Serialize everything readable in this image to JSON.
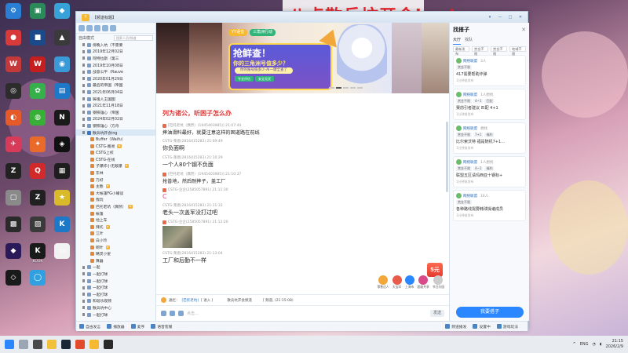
{
  "overlay_text": "八点散兵坑开会ing!",
  "desktop_icons": [
    {
      "label": "",
      "color": "#2a7fd4",
      "glyph": "⚙"
    },
    {
      "label": "",
      "color": "#2a8a5a",
      "glyph": "▣"
    },
    {
      "label": "",
      "color": "#36a2d8",
      "glyph": "◆"
    },
    {
      "label": "",
      "color": "#d83a3a",
      "glyph": "●"
    },
    {
      "label": "",
      "color": "#1a4a8a",
      "glyph": "■"
    },
    {
      "label": "",
      "color": "#3a3a3a",
      "glyph": "▲"
    },
    {
      "label": "",
      "color": "#c43a3a",
      "glyph": "W"
    },
    {
      "label": "",
      "color": "#c41e1e",
      "glyph": "W"
    },
    {
      "label": "",
      "color": "#3a9ad8",
      "glyph": "◉"
    },
    {
      "label": "",
      "color": "#2c2c2c",
      "glyph": "◎"
    },
    {
      "label": "",
      "color": "#35b04a",
      "glyph": "✿"
    },
    {
      "label": "",
      "color": "#1e78c8",
      "glyph": "▤"
    },
    {
      "label": "",
      "color": "#e65a2a",
      "glyph": "◐"
    },
    {
      "label": "",
      "color": "#38b038",
      "glyph": "◍"
    },
    {
      "label": "",
      "color": "#1a1a1a",
      "glyph": "N"
    },
    {
      "label": "",
      "color": "#d83a5a",
      "glyph": "✈"
    },
    {
      "label": "",
      "color": "#ea6a2a",
      "glyph": "✦"
    },
    {
      "label": "",
      "color": "#111111",
      "glyph": "◈"
    },
    {
      "label": "",
      "color": "#222222",
      "glyph": "Z"
    },
    {
      "label": "",
      "color": "#d22a2a",
      "glyph": "Q"
    },
    {
      "label": "",
      "color": "#1e1e1e",
      "glyph": "▦"
    },
    {
      "label": "",
      "color": "#8a8a8a",
      "glyph": "▢"
    },
    {
      "label": "",
      "color": "#202020",
      "glyph": "Z"
    },
    {
      "label": "",
      "color": "#d8ba2a",
      "glyph": "★"
    },
    {
      "label": "",
      "color": "#2a2a2a",
      "glyph": "▩"
    },
    {
      "label": "",
      "color": "#3a3a3a",
      "glyph": "▨"
    },
    {
      "label": "",
      "color": "#1e78c8",
      "glyph": "K"
    },
    {
      "label": "",
      "color": "#2a1a5a",
      "glyph": "◆"
    },
    {
      "label": "KOOK",
      "color": "#1a1a1a",
      "glyph": "K"
    },
    {
      "label": "",
      "color": "#f2f2f2",
      "glyph": "▭"
    },
    {
      "label": "",
      "color": "#1a1a1a",
      "glyph": "◇"
    },
    {
      "label": "",
      "color": "#30a0e0",
      "glyph": "◯"
    }
  ],
  "window": {
    "title": "【频道标题】",
    "title_btn_1": "▾",
    "title_btn_min": "—",
    "title_btn_max": "□",
    "title_btn_close": "✕"
  },
  "tree": {
    "mode_label": "自由模式",
    "search_placeholder": "搜索人员/频道",
    "rows": [
      {
        "label": "傍晚入坑（不需要",
        "indent": "channel",
        "color": "#7a9cc4"
      },
      {
        "label": "2019年12月02日",
        "indent": "channel",
        "color": "#7a9cc4"
      },
      {
        "label": "阿特拉斯（第三",
        "indent": "channel",
        "color": "#7a9cc4"
      },
      {
        "label": "2019年10月08日",
        "indent": "channel",
        "color": "#7a9cc4"
      },
      {
        "label": "战意公平（Rauve",
        "indent": "channel",
        "color": "#7a9cc4"
      },
      {
        "label": "2020年01月29日",
        "indent": "channel",
        "color": "#7a9cc4"
      },
      {
        "label": "最后的帝国（帝国",
        "indent": "channel",
        "color": "#7a9cc4"
      },
      {
        "label": "2021年06月04日",
        "indent": "channel",
        "color": "#7a9cc4"
      },
      {
        "label": "铸魂人王国图",
        "indent": "channel",
        "color": "#7a9cc4"
      },
      {
        "label": "2021年11月18日",
        "indent": "channel",
        "color": "#7a9cc4"
      },
      {
        "label": "钢铁雄心（帝国",
        "indent": "channel",
        "color": "#7a9cc4"
      },
      {
        "label": "2024年02月02日",
        "indent": "channel",
        "color": "#7a9cc4"
      },
      {
        "label": "钢铁雄心（方舟",
        "indent": "channel",
        "color": "#7a9cc4"
      },
      {
        "label": "散兵坑开会ing",
        "indent": "channel sel",
        "color": "#3a76c4"
      },
      {
        "label": "Buffer（Waifu）",
        "indent": "member",
        "color": "#e08a3a"
      },
      {
        "label": "CSTG-路易",
        "indent": "member",
        "color": "#e08a3a"
      },
      {
        "label": "CSTG上校",
        "indent": "member",
        "color": "#e08a3a"
      },
      {
        "label": "CSTG-在线",
        "indent": "member",
        "color": "#e08a3a"
      },
      {
        "label": "子爆炸小无敌爆",
        "indent": "member",
        "color": "#e08a3a"
      },
      {
        "label": "东林",
        "indent": "member",
        "color": "#e08a3a"
      },
      {
        "label": "乃好",
        "indent": "member",
        "color": "#e08a3a"
      },
      {
        "label": "主胜",
        "indent": "member",
        "color": "#e08a3a"
      },
      {
        "label": "大帐篷FG小嘴谈",
        "indent": "member",
        "color": "#e08a3a"
      },
      {
        "label": "我玩",
        "indent": "member",
        "color": "#e08a3a"
      },
      {
        "label": "巴托老坑（偶然）",
        "indent": "member",
        "color": "#e08a3a"
      },
      {
        "label": "帐篷",
        "indent": "member",
        "color": "#e08a3a"
      },
      {
        "label": "他上车",
        "indent": "member",
        "color": "#e08a3a"
      },
      {
        "label": "拜托",
        "indent": "member",
        "color": "#e08a3a"
      },
      {
        "label": "江叶",
        "indent": "member",
        "color": "#e08a3a"
      },
      {
        "label": "白小玲",
        "indent": "member",
        "color": "#e08a3a"
      },
      {
        "label": "砌叶",
        "indent": "member",
        "color": "#e08a3a"
      },
      {
        "label": "精灵小星",
        "indent": "member",
        "color": "#e08a3a"
      },
      {
        "label": "算器",
        "indent": "member",
        "color": "#e08a3a"
      },
      {
        "label": "一起",
        "indent": "channel",
        "color": "#7a9cc4"
      },
      {
        "label": "一起打球",
        "indent": "channel",
        "color": "#7a9cc4"
      },
      {
        "label": "一起打球",
        "indent": "channel",
        "color": "#7a9cc4"
      },
      {
        "label": "一起打球",
        "indent": "channel",
        "color": "#7a9cc4"
      },
      {
        "label": "一起打球",
        "indent": "channel",
        "color": "#7a9cc4"
      },
      {
        "label": "和谐乐观频",
        "indent": "channel",
        "color": "#7a9cc4"
      },
      {
        "label": "散兵坑中心",
        "indent": "channel",
        "color": "#7a9cc4"
      },
      {
        "label": "一起打球",
        "indent": "channel",
        "color": "#7a9cc4"
      }
    ]
  },
  "banner": {
    "logo_1": "YY语音",
    "logo_2": "三角洲行动",
    "headline": "抢鲜查！",
    "subline": "你的三角洲号值多少？",
    "pill": "你的账号值多少-AI一键全查了",
    "tag_1": "专业评估",
    "tag_2": "安全无忧"
  },
  "notice": "列为诸公，听困子怎么办",
  "messages": [
    {
      "head": "[巴托老坑（偶然）(1945403985)] 21:07:44",
      "body": "摔油滑料最好，就要注意这样的固道路在前线",
      "style": "normal",
      "gift": true
    },
    {
      "head": "CSTG-莱恩(2816415283) 21:09:49",
      "body": "你负面啊",
      "style": "big",
      "gift": false
    },
    {
      "head": "CSTG-莱恩(2816415283) 21:10:29",
      "body": "一个人80个钢不负面",
      "style": "big",
      "gift": false
    },
    {
      "head": "[巴托老坑（偶然）(1945403985)] 21:10:37",
      "body": "抢普地，然后耐摔子，盖工厂",
      "style": "normal",
      "gift": true
    },
    {
      "head": "CSTG-企企(2585057891) 21:11:30",
      "body": "C",
      "style": "red",
      "gift": true
    },
    {
      "head": "CSTG-莱恩(2816415283) 21:11:33",
      "body": "老头一次盖军没打过吧",
      "style": "big",
      "gift": false
    },
    {
      "head": "CSTG-企企(2585057891) 21:12:20",
      "body": "",
      "style": "image",
      "gift": true
    },
    {
      "head": "CSTG-莱恩(2816415283) 21:13:04",
      "body": "工厂和后勤不一样",
      "style": "big",
      "gift": false
    }
  ],
  "voicebar": {
    "mode": "通栏：",
    "link": "[巴托老坑]",
    "tail": "[ 进入 ]",
    "right_1": "散兵坑开会频道",
    "right_2": "[ 频道, (21:15:08)"
  },
  "gift_bar": {
    "five": "5元",
    "items": [
      "零售达人",
      "天宝印",
      "上海市",
      "超级共享"
    ],
    "extra": "节日乐园"
  },
  "input": {
    "placeholder": "点击...",
    "send": "发送"
  },
  "right": {
    "title": "找搭子",
    "close": "✕",
    "tabs": [
      "大厅",
      "找队"
    ],
    "filters": [
      "最新发布",
      "赏金不限",
      "赏金不限",
      "地域不限"
    ],
    "cards": [
      {
        "name": "网络联盟",
        "count": "3人",
        "tags": [
          "赏金不限"
        ],
        "body": "417需要帮助炸弹",
        "foot": "1分钟前发布"
      },
      {
        "name": "网络联盟",
        "count": "1人想找",
        "tags": [
          "赏金不限",
          "4~1",
          "匹配"
        ],
        "body": "赛前引者建议 匹配 4+1",
        "foot": "1分钟前发布"
      },
      {
        "name": "网络联盟",
        "count": "想找",
        "tags": [
          "赏金不限",
          "7+1",
          "福利"
        ],
        "body": "比尔索沃特 福是随机7+1...",
        "foot": "1分钟前发布"
      },
      {
        "name": "网络联盟",
        "count": "1人想找",
        "tags": [
          "赏金不限",
          "4~1",
          "福利"
        ],
        "body": "联盟五区请玛西亚十钢标+",
        "foot": "1分钟前发布"
      },
      {
        "name": "网络联盟",
        "count": "16人",
        "tags": [
          "赏金不限"
        ],
        "body": "各种路线需要韩球操诸成员",
        "foot": "1分钟前发布"
      }
    ],
    "button": "我要搭子"
  },
  "bottombar": {
    "items": [
      "自由发言",
      "播放器",
      "麦序",
      "语音客服"
    ],
    "right_items": [
      "频道播发",
      "设置中",
      "游戏玩法"
    ]
  },
  "clock": {
    "time": "21:15",
    "date": "2026/2/9"
  },
  "tray_text": "ENG"
}
